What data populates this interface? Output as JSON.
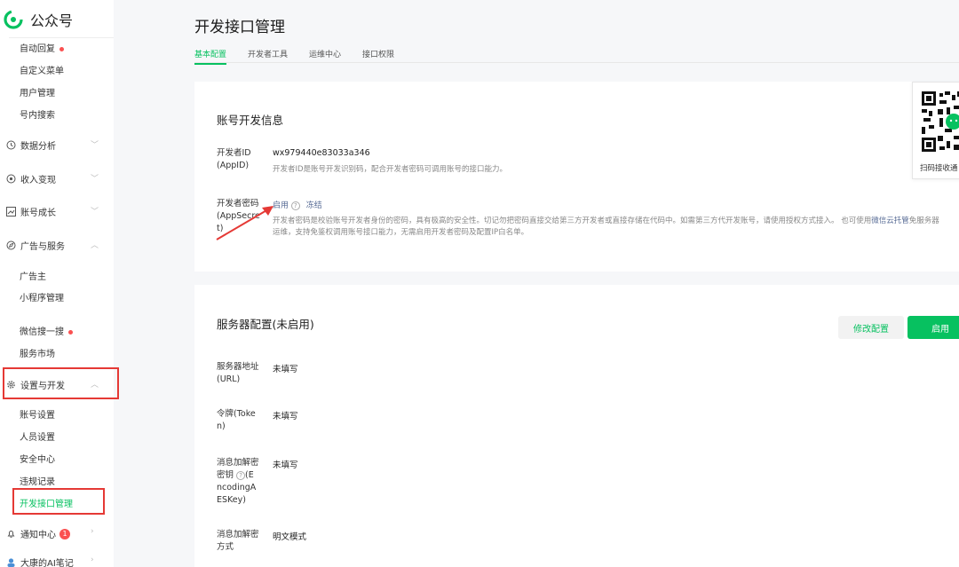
{
  "app": {
    "name": "公众号"
  },
  "sidebar": {
    "top_items": [
      {
        "label": "自动回复",
        "dot": true
      },
      {
        "label": "自定义菜单"
      },
      {
        "label": "用户管理"
      },
      {
        "label": "号内搜索"
      }
    ],
    "groups": {
      "analytics": "数据分析",
      "monetize": "收入变现",
      "growth": "账号成长",
      "ads": "广告与服务",
      "settings": "设置与开发",
      "notify": "通知中心",
      "ai": "大康的AI笔记"
    },
    "ads_items": [
      "广告主",
      "小程序管理",
      "微信搜一搜",
      "服务市场"
    ],
    "settings_items": [
      "账号设置",
      "人员设置",
      "安全中心",
      "违规记录",
      "开发接口管理"
    ],
    "notify_badge": "1"
  },
  "page": {
    "title": "开发接口管理",
    "tabs": [
      "基本配置",
      "开发者工具",
      "运维中心",
      "接口权限"
    ]
  },
  "dev_info": {
    "title": "账号开发信息",
    "appid_label_1": "开发者ID",
    "appid_label_2": "(AppID)",
    "appid_value": "wx979440e83033a346",
    "appid_hint": "开发者ID是账号开发识别码，配合开发者密码可调用账号的接口能力。",
    "secret_label_1": "开发者密码",
    "secret_label_2": "(AppSecre",
    "secret_label_3": "t)",
    "secret_enable": "启用",
    "secret_freeze": "冻结",
    "secret_hint_1a": "开发者密码是校验账号开发者身份的密码，具有极高的安全性。切记勿把密码直接交给第三方开发者或直接存储在代码中。如需第三方代开发账号，请使用授权方式接入。 也可使用",
    "secret_hint_link": "微信云托管",
    "secret_hint_1b": "免服务器",
    "secret_hint_2": "运维，支持免鉴权调用账号接口能力，无需启用开发者密码及配置IP白名单。"
  },
  "qr": {
    "caption": "扫码接收通"
  },
  "server": {
    "title": "服务器配置(未启用)",
    "modify_label": "修改配置",
    "enable_label": "启用",
    "url_label_1": "服务器地址",
    "url_label_2": "(URL)",
    "url_value": "未填写",
    "token_label_1": "令牌(Toke",
    "token_label_2": "n)",
    "token_value": "未填写",
    "aes_label_1": "消息加解密",
    "aes_label_2a": "密钥",
    "aes_label_2b": "(E",
    "aes_label_3": "ncodingA",
    "aes_label_4": "ESKey)",
    "aes_value": "未填写",
    "mode_label_1": "消息加解密",
    "mode_label_2": "方式",
    "mode_value": "明文模式"
  },
  "colors": {
    "accent": "#07c160",
    "link": "#576b95",
    "annotation": "#e53935"
  }
}
